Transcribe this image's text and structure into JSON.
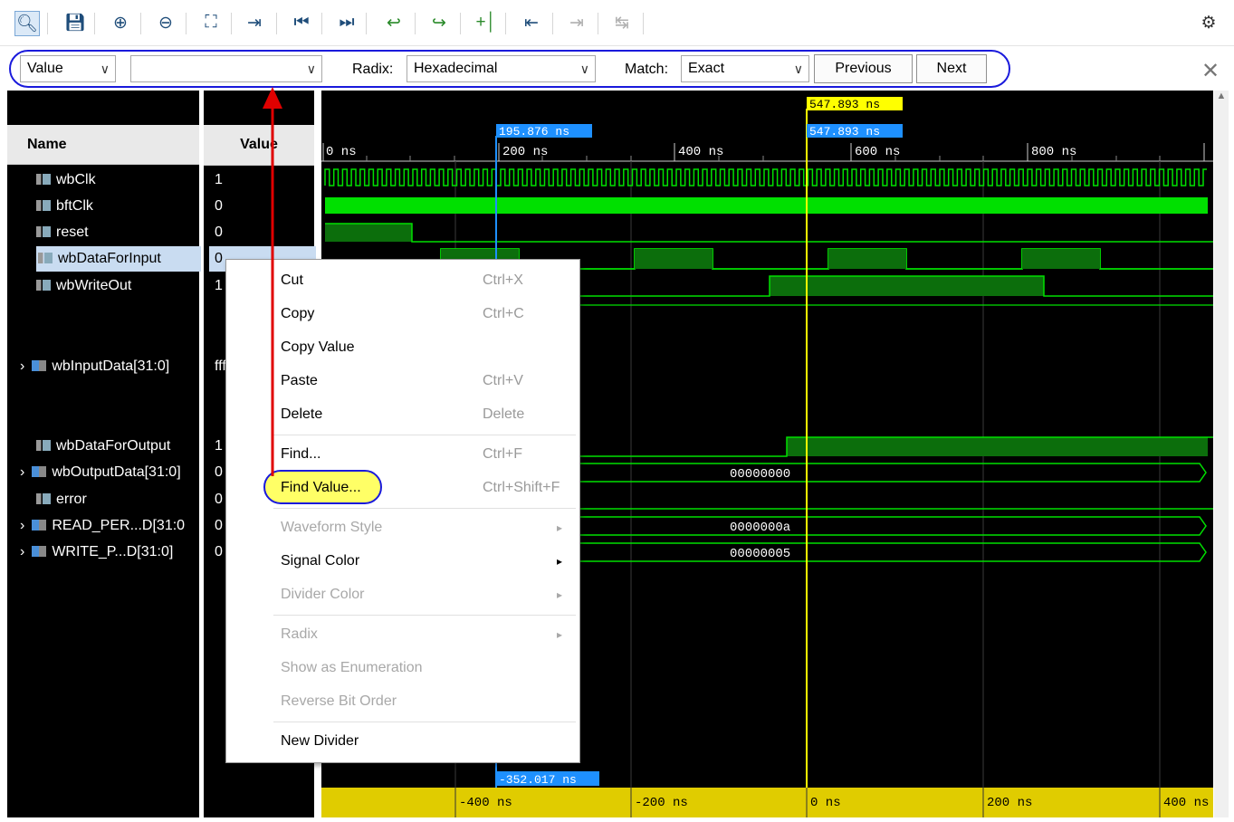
{
  "findbar": {
    "type": "Value",
    "value": "",
    "radix_label": "Radix:",
    "radix": "Hexadecimal",
    "match_label": "Match:",
    "match": "Exact",
    "previous": "Previous",
    "next": "Next"
  },
  "columns": {
    "name": "Name",
    "value": "Value"
  },
  "signals": [
    {
      "name": "wbClk",
      "value": "1",
      "kind": "bit"
    },
    {
      "name": "bftClk",
      "value": "0",
      "kind": "bit"
    },
    {
      "name": "reset",
      "value": "0",
      "kind": "bit"
    },
    {
      "name": "wbDataForInput",
      "value": "0",
      "kind": "bit"
    },
    {
      "name": "wbWriteOut",
      "value": "1",
      "kind": "bit"
    },
    {
      "name": "wbInputData[31:0]",
      "value": "fff",
      "kind": "bus"
    },
    {
      "name": "wbDataForOutput",
      "value": "1",
      "kind": "bit"
    },
    {
      "name": "wbOutputData[31:0]",
      "value": "0",
      "kind": "bus"
    },
    {
      "name": "error",
      "value": "0",
      "kind": "bit"
    },
    {
      "name": "READ_PER...D[31:0",
      "value": "0",
      "kind": "bus"
    },
    {
      "name": "WRITE_P...D[31:0]",
      "value": "0",
      "kind": "bus"
    }
  ],
  "timeline": {
    "cursor_blue": "195.876 ns",
    "cursor_yellow_top": "547.893 ns",
    "cursor_yellow": "547.893 ns",
    "delta": "-352.017 ns",
    "ticks": [
      "0 ns",
      "200 ns",
      "400 ns",
      "600 ns",
      "800 ns"
    ],
    "bottom_ticks": [
      "-400 ns",
      "-200 ns",
      "0 ns",
      "200 ns",
      "400 ns"
    ]
  },
  "bus_values": {
    "wbOutputData": "00000000",
    "read_period": "0000000a",
    "write_period": "00000005"
  },
  "menu": [
    {
      "label": "Cut",
      "shortcut": "Ctrl+X",
      "enabled": true
    },
    {
      "label": "Copy",
      "shortcut": "Ctrl+C",
      "enabled": true
    },
    {
      "label": "Copy Value",
      "shortcut": "",
      "enabled": true
    },
    {
      "label": "Paste",
      "shortcut": "Ctrl+V",
      "enabled": true
    },
    {
      "label": "Delete",
      "shortcut": "Delete",
      "enabled": true
    },
    {
      "label": "Find...",
      "shortcut": "Ctrl+F",
      "enabled": true
    },
    {
      "label": "Find Value...",
      "shortcut": "Ctrl+Shift+F",
      "enabled": true
    },
    {
      "label": "Waveform Style",
      "shortcut": "",
      "enabled": false
    },
    {
      "label": "Signal Color",
      "shortcut": "",
      "enabled": true
    },
    {
      "label": "Divider Color",
      "shortcut": "",
      "enabled": false
    },
    {
      "label": "Radix",
      "shortcut": "",
      "enabled": false
    },
    {
      "label": "Show as Enumeration",
      "shortcut": "",
      "enabled": false
    },
    {
      "label": "Reverse Bit Order",
      "shortcut": "",
      "enabled": false
    },
    {
      "label": "New Divider",
      "shortcut": "",
      "enabled": true
    }
  ],
  "colors": {
    "waveform": "#00e000",
    "cursor_blue": "#1e90ff",
    "cursor_yellow": "#ffff00",
    "annotation_red": "#e00000",
    "highlight_yellow": "#ffff66",
    "highlight_ring": "#1a1adc"
  }
}
